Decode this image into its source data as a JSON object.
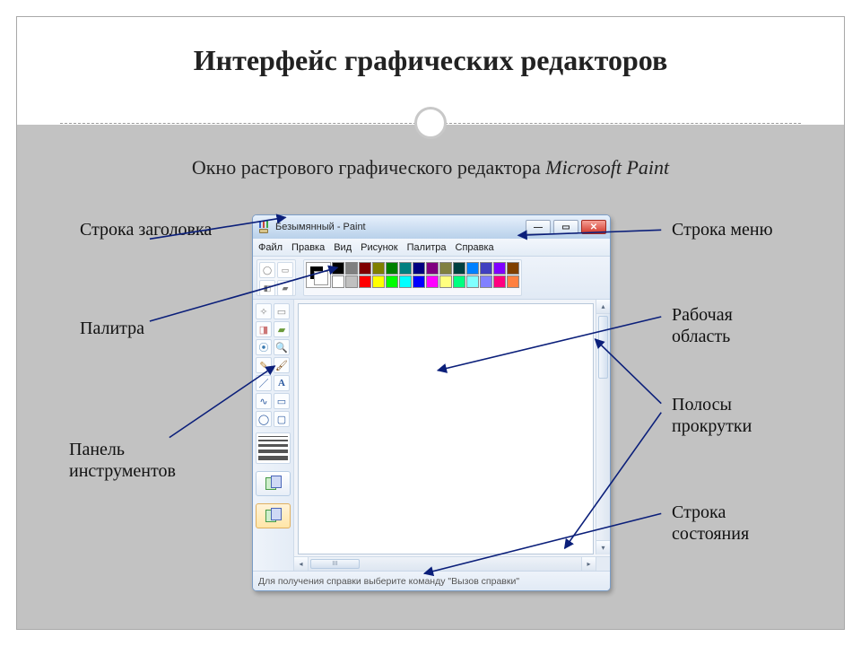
{
  "slide": {
    "title": "Интерфейс графических редакторов",
    "subtitle_plain": "Окно растрового графического редактора ",
    "subtitle_em": "Microsoft Paint"
  },
  "labels": {
    "title_bar": "Строка заголовка",
    "menu_bar": "Строка меню",
    "palette": "Палитра",
    "workspace": "Рабочая область",
    "toolbar": "Панель инструментов",
    "scrollbars": "Полосы прокрутки",
    "status_bar": "Строка состояния"
  },
  "paint": {
    "title": "Безымянный - Paint",
    "menu": [
      "Файл",
      "Правка",
      "Вид",
      "Рисунок",
      "Палитра",
      "Справка"
    ],
    "status": "Для получения справки выберите команду \"Вызов справки\"",
    "hscroll_thumb": "III",
    "palette_colors_row1": [
      "#000000",
      "#808080",
      "#800000",
      "#808000",
      "#008000",
      "#008080",
      "#000080",
      "#800080",
      "#808040",
      "#004040",
      "#0080ff",
      "#4040c0",
      "#8000ff",
      "#804000"
    ],
    "palette_colors_row2": [
      "#ffffff",
      "#c0c0c0",
      "#ff0000",
      "#ffff00",
      "#00ff00",
      "#00ffff",
      "#0000ff",
      "#ff00ff",
      "#ffff80",
      "#00ff80",
      "#80ffff",
      "#8080ff",
      "#ff0080",
      "#ff8040"
    ]
  },
  "arrow_color": "#0b1f7a"
}
